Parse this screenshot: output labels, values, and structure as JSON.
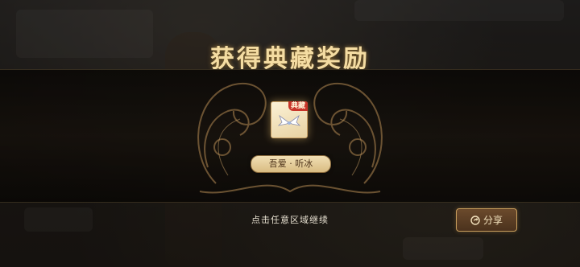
{
  "dialog": {
    "title": "获得典藏奖励",
    "continue_hint": "点击任意区域继续"
  },
  "reward": {
    "badge": "典藏",
    "name": "吾爱 · 听冰",
    "icon": "wing-hairpiece-icon"
  },
  "share_button": {
    "label": "分享",
    "icon": "share-icon"
  },
  "colors": {
    "title": "#f4dca2",
    "badge": "#c8352a",
    "plate": "#e6cd97",
    "button_border": "#c79d5c"
  }
}
